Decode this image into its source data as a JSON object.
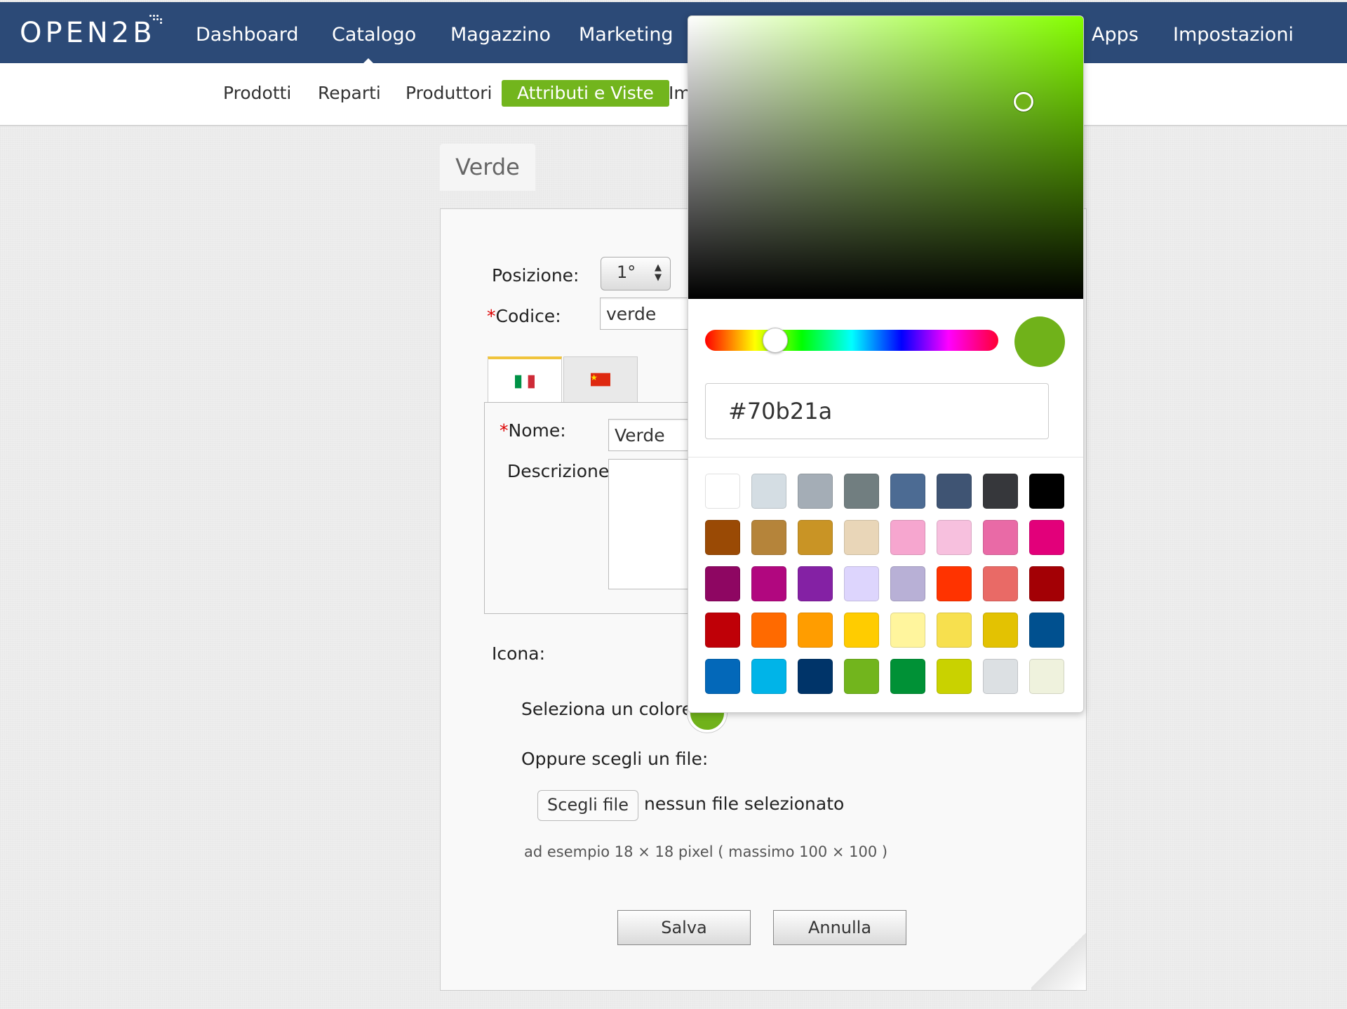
{
  "logo": {
    "text": "OPEN2B"
  },
  "mainnav": [
    "Dashboard",
    "Catalogo",
    "Magazzino",
    "Marketing",
    "Apps",
    "Impostazioni"
  ],
  "subnav": [
    "Prodotti",
    "Reparti",
    "Produttori",
    "Attributi e Viste",
    "Im"
  ],
  "title": "Verde",
  "form": {
    "posizione_label": "Posizione:",
    "posizione_value": "1°",
    "codice_req": "*",
    "codice_label": "Codice:",
    "codice_value": "verde",
    "nome_req": "*",
    "nome_label": "Nome:",
    "nome_value": "Verde",
    "descrizione_label": "Descrizione:",
    "icona_label": "Icona:",
    "colore_label": "Seleziona un colore:",
    "file_label": "Oppure scegli un file:",
    "file_button": "Scegli file",
    "file_status": "nessun file selezionato",
    "hint": "ad esempio 18 × 18 pixel ( massimo 100 × 100 )",
    "save": "Salva",
    "cancel": "Annulla",
    "selected_color": "#70b21a"
  },
  "languages": [
    "Italiano",
    "Cinese"
  ],
  "picker": {
    "hex": "#70b21a",
    "swatches": [
      "#ffffff",
      "#d4dde3",
      "#a4adb6",
      "#717e80",
      "#4c6b93",
      "#3f5473",
      "#36373b",
      "#000000",
      "#9a4a05",
      "#b5843a",
      "#c99425",
      "#e9d6b8",
      "#f6a6cf",
      "#f7c0de",
      "#e96aa6",
      "#e2007a",
      "#8e0662",
      "#b1077f",
      "#8421a4",
      "#ddd5fd",
      "#b8b0d6",
      "#ff3300",
      "#e96a66",
      "#a30005",
      "#bf0007",
      "#ff6a00",
      "#ff9d00",
      "#ffcc00",
      "#fff59d",
      "#f7e04e",
      "#e3c202",
      "#00508f",
      "#0368b9",
      "#00b4e8",
      "#003469",
      "#72b51d",
      "#009136",
      "#c9d200",
      "#dce0e3",
      "#eff2dd"
    ]
  }
}
